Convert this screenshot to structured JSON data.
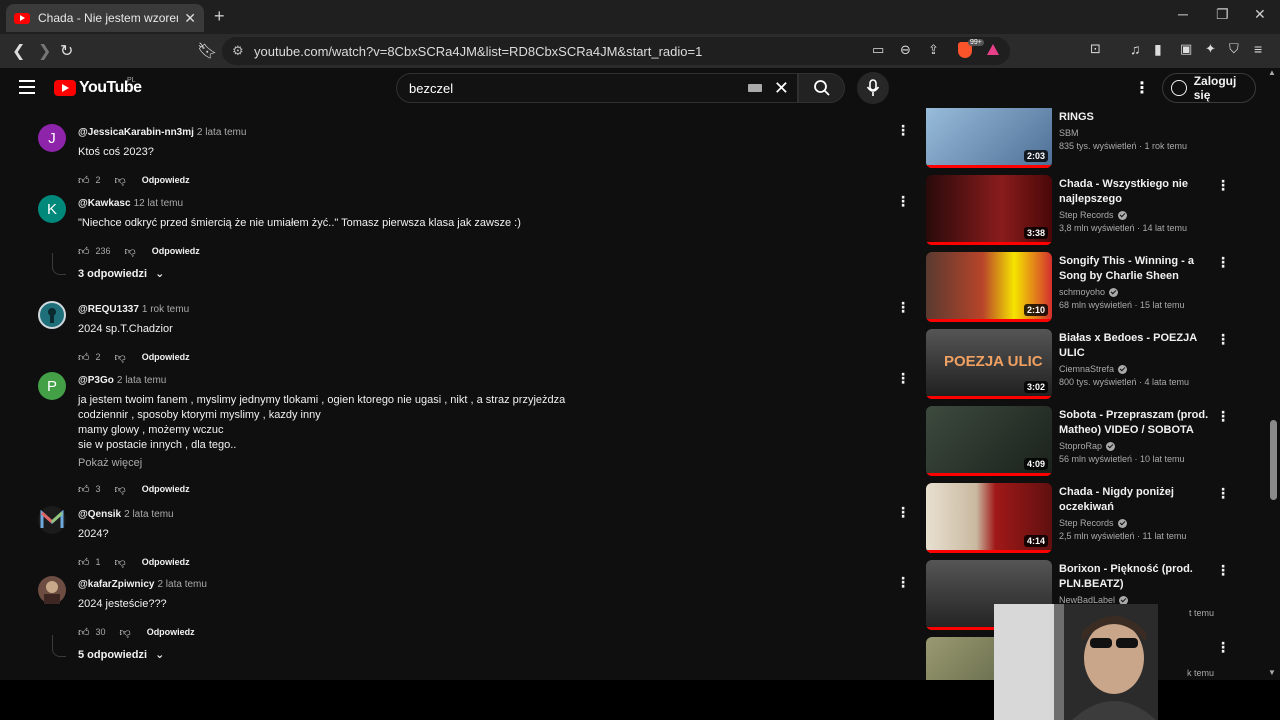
{
  "browser": {
    "tab_title": "Chada - Nie jestem wzorem świ",
    "tab_close": "✕",
    "new_tab": "+",
    "url": "youtube.com/watch?v=8CbxSCRa4JM&list=RD8CbxSCRa4JM&start_radio=1",
    "brave_badge": "99+"
  },
  "header": {
    "logo_text": "YouTube",
    "logo_region": "PL",
    "search_value": "bezczel",
    "signin_label": "Zaloguj się"
  },
  "comments": [
    {
      "author": "@JessicaKarabin-nn3mj",
      "age": "2 lata temu",
      "text": "Ktoś coś 2023?",
      "likes": "2",
      "reply": "Odpowiedz",
      "avatar_letter": "J",
      "avatar_color": "#8e24aa"
    },
    {
      "author": "@Kawkasc",
      "age": "12 lat temu",
      "text": "\"Niechce odkryć przed śmiercią że nie umiałem żyć..\" Tomasz pierwsza klasa jak zawsze  :)",
      "likes": "236",
      "reply": "Odpowiedz",
      "avatar_letter": "K",
      "avatar_color": "#00897b",
      "replies": "3 odpowiedzi"
    },
    {
      "author": "@REQU1337",
      "age": "1 rok temu",
      "text": "2024 sp.T.Chadzior",
      "likes": "2",
      "reply": "Odpowiedz",
      "avatar_letter": "",
      "avatar_color": "#1e6f7a"
    },
    {
      "author": "@P3Go",
      "age": "2 lata temu",
      "text": "ja jestem twoim fanem , myslimy jednymy tlokami , ogien ktorego nie ugasi , nikt , a straz przyjeżdza\ncodziennir , sposoby ktorymi myslimy ,  kazdy inny\nmamy glowy  , możemy wczuc\nsie w postacie innych , dla tego..",
      "more": "Pokaż więcej",
      "likes": "3",
      "reply": "Odpowiedz",
      "avatar_letter": "P",
      "avatar_color": "#43a047"
    },
    {
      "author": "@Qensik",
      "age": "2 lata temu",
      "text": "2024?",
      "likes": "1",
      "reply": "Odpowiedz",
      "avatar_letter": "",
      "avatar_color": "#5c6bc0"
    },
    {
      "author": "@kafarZpiwnicy",
      "age": "2 lata temu",
      "text": "2024 jesteście???",
      "likes": "30",
      "reply": "Odpowiedz",
      "avatar_letter": "",
      "avatar_color": "#6d4c41",
      "replies": "5 odpowiedzi"
    }
  ],
  "sidebar": [
    {
      "title": "RINGS",
      "channel": "SBM",
      "verified": false,
      "views": "835 tys. wyświetleń · 1 rok temu",
      "duration": "2:03",
      "thumb_color": "#7fa6c8"
    },
    {
      "title": "Chada - Wszystkiego nie najlepszego",
      "channel": "Step Records",
      "verified": true,
      "views": "3,8 mln wyświetleń · 14 lat temu",
      "duration": "3:38",
      "thumb_color": "#8a1c1c"
    },
    {
      "title": "Songify This - Winning - a Song by Charlie Sheen",
      "channel": "schmoyoho",
      "verified": true,
      "views": "68 mln wyświetleń · 15 lat temu",
      "duration": "2:10",
      "thumb_color": "#b8442a"
    },
    {
      "title": "Białas x Bedoes - POEZJA ULIC",
      "channel": "CiemnaStrefa",
      "verified": true,
      "views": "800 tys. wyświetleń · 4 lata temu",
      "duration": "3:02",
      "thumb_color": "#3a3a3a",
      "thumb_text": "POEZJA ULIC"
    },
    {
      "title": "Sobota - Przepraszam (prod. Matheo) VIDEO / SOBOTA",
      "channel": "StoproRap",
      "verified": true,
      "views": "56 mln wyświetleń · 10 lat temu",
      "duration": "4:09",
      "thumb_color": "#2f3a30"
    },
    {
      "title": "Chada - Nigdy poniżej oczekiwań",
      "channel": "Step Records",
      "verified": true,
      "views": "2,5 mln wyświetleń · 11 lat temu",
      "duration": "4:14",
      "thumb_color": "#a01818"
    },
    {
      "title": "Borixon - Piękność (prod. PLN.BEATZ)",
      "channel": "NewBadLabel",
      "verified": true,
      "views": "t temu",
      "duration": "",
      "thumb_color": "#444444"
    },
    {
      "title": "",
      "channel": "",
      "verified": false,
      "views": "k temu",
      "duration": "",
      "thumb_color": "#7a7a5a"
    }
  ]
}
